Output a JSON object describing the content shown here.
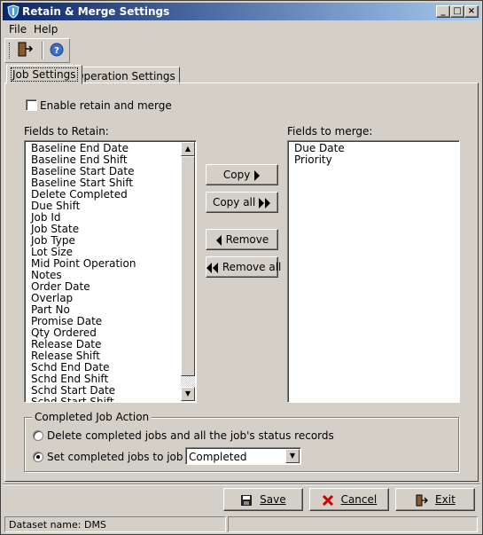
{
  "window": {
    "title": "Retain & Merge Settings"
  },
  "menu": {
    "file": "File",
    "help": "Help"
  },
  "tabs": [
    {
      "label": "Job Settings"
    },
    {
      "label": "Operation Settings"
    }
  ],
  "job_settings": {
    "enable_label": "Enable retain and merge",
    "retain_label": "Fields to Retain:",
    "merge_label": "Fields to merge:",
    "retain_fields": [
      "Baseline End Date",
      "Baseline End Shift",
      "Baseline Start Date",
      "Baseline Start Shift",
      "Delete Completed",
      "Due Shift",
      "Job Id",
      "Job State",
      "Job Type",
      "Lot Size",
      "Mid Point Operation",
      "Notes",
      "Order Date",
      "Overlap",
      "Part No",
      "Promise Date",
      "Qty Ordered",
      "Release Date",
      "Release Shift",
      "Schd End Date",
      "Schd End Shift",
      "Schd Start Date",
      "Schd Start Shift"
    ],
    "merge_fields": [
      "Due Date",
      "Priority"
    ],
    "buttons": {
      "copy": "Copy",
      "copy_all": "Copy all",
      "remove": "Remove",
      "remove_all": "Remove all"
    },
    "completed_group": {
      "title": "Completed Job Action",
      "option_delete": "Delete completed jobs and all the job's status records",
      "option_set_state": "Set completed jobs to job state",
      "job_state_value": "Completed"
    }
  },
  "footer": {
    "save": "Save",
    "cancel": "Cancel",
    "exit": "Exit"
  },
  "status": {
    "dataset": "Dataset name:  DMS"
  },
  "colors": {
    "title_start": "#0a246a",
    "title_end": "#a6caf0",
    "face": "#d4d0c8",
    "cancel_red": "#cc0000"
  }
}
